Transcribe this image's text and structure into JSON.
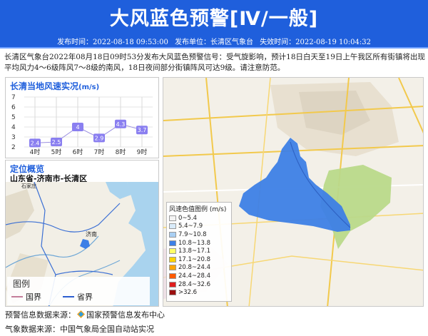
{
  "header": {
    "title": "大风蓝色预警[Ⅳ/一般]",
    "publish_time": "发布时间：2022-08-18 09:53:00",
    "publish_unit": "发布单位：长清区气象台",
    "expire_time": "失效时间：2022-08-19 10:04:32"
  },
  "description": "长清区气象台2022年08月18日09时53分发布大风蓝色预警信号：受气旋影响，预计18日白天至19日上午我区所有街镇将出现平均风力4～6级阵风7～8级的南风，18日夜间部分街镇阵风可达9级。请注意防范。",
  "wind_panel": {
    "title": "长清当地风速实况",
    "unit": "(m/s)"
  },
  "chart_data": {
    "type": "line",
    "title": "长清当地风速实况 (m/s)",
    "categories": [
      "4时",
      "5时",
      "6时",
      "7时",
      "8时",
      "9时"
    ],
    "values": [
      2.4,
      2.5,
      4,
      2.9,
      4.3,
      3.7
    ],
    "value_labels": [
      "2.4",
      "2.5",
      "4",
      "2.9",
      "4.3",
      "3.7"
    ],
    "yticks": [
      "2",
      "3",
      "4",
      "5",
      "6",
      "7"
    ],
    "ylim": [
      2,
      7
    ],
    "grid": true
  },
  "location_panel": {
    "title": "定位概览",
    "region": "山东省-济南市-长清区",
    "map_labels": {
      "shijiazhuang": "石家庄",
      "jinan": "济南"
    },
    "legend_title": "图例",
    "legend_country": "国界",
    "legend_province": "省界"
  },
  "map_legend": {
    "title": "风速色值图例 (m/s)",
    "items": [
      {
        "label": "0~5.4",
        "color": "#f4f4f4"
      },
      {
        "label": "5.4~7.9",
        "color": "#d9ebfa"
      },
      {
        "label": "7.9~10.8",
        "color": "#a9cff3"
      },
      {
        "label": "10.8~13.8",
        "color": "#3d7fe6"
      },
      {
        "label": "13.8~17.1",
        "color": "#ffff66"
      },
      {
        "label": "17.1~20.8",
        "color": "#ffd400"
      },
      {
        "label": "20.8~24.4",
        "color": "#ffa500"
      },
      {
        "label": "24.4~28.4",
        "color": "#ff5a00"
      },
      {
        "label": "28.4~32.6",
        "color": "#e01e1e"
      },
      {
        "label": ">32.6",
        "color": "#9b0f0f"
      }
    ]
  },
  "footer": {
    "warning_source": "预警信息数据来源：",
    "warning_source_name": "国家预警信息发布中心",
    "weather_source": "气象数据来源：中国气象局全国自动站实况"
  }
}
